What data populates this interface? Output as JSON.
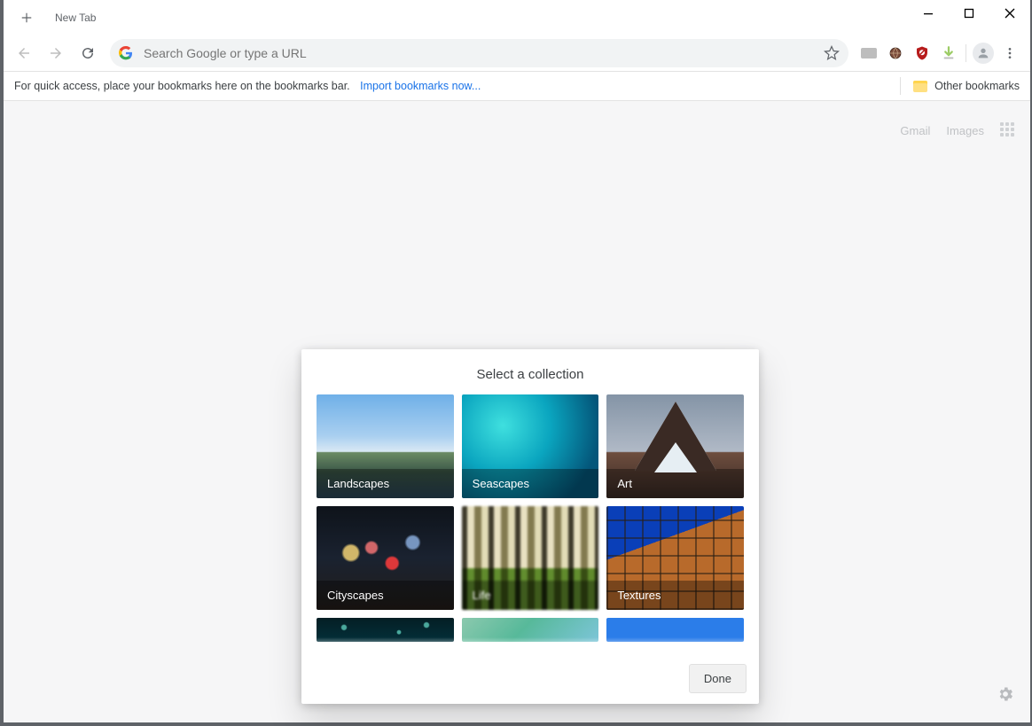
{
  "window": {
    "tab_title": "New Tab"
  },
  "toolbar": {
    "omnibox_placeholder": "Search Google or type a URL"
  },
  "bookmarks_bar": {
    "hint": "For quick access, place your bookmarks here on the bookmarks bar.",
    "import_link": "Import bookmarks now...",
    "other_bookmarks": "Other bookmarks"
  },
  "ntp": {
    "gmail": "Gmail",
    "images": "Images"
  },
  "dialog": {
    "title": "Select a collection",
    "done": "Done",
    "collections": [
      {
        "label": "Landscapes",
        "bg": "bg-landscapes"
      },
      {
        "label": "Seascapes",
        "bg": "bg-seascapes"
      },
      {
        "label": "Art",
        "bg": "bg-art"
      },
      {
        "label": "Cityscapes",
        "bg": "bg-cityscapes"
      },
      {
        "label": "Life",
        "bg": "bg-life"
      },
      {
        "label": "Textures",
        "bg": "bg-textures"
      }
    ],
    "extra_row_bgs": [
      "bg-extra1",
      "bg-extra2",
      "bg-extra3"
    ]
  }
}
